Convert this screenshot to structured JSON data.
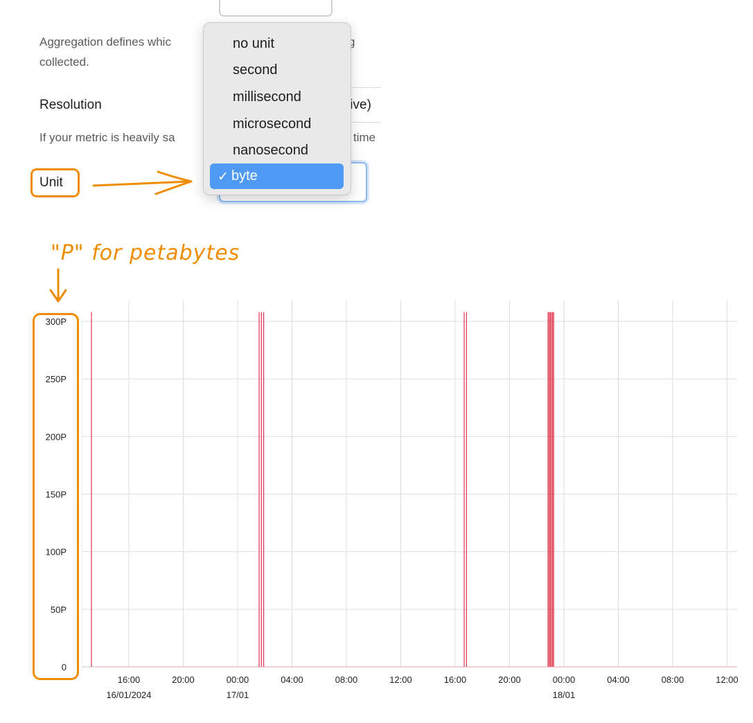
{
  "form": {
    "aggregation_text_line1_left": "Aggregation defines whic",
    "aggregation_text_line1_right": "g",
    "aggregation_text_line2": "collected.",
    "resolution_label": "Resolution",
    "resolution_value_fragment": "tive)",
    "resolution_help_left": "If your metric is heavily sa",
    "resolution_help_right": "time",
    "unit_label": "Unit"
  },
  "dropdown": {
    "options": [
      "no unit",
      "second",
      "millisecond",
      "microsecond",
      "nanosecond",
      "byte"
    ],
    "selected": "byte",
    "check_glyph": "✓"
  },
  "annotation": {
    "text": "\"P\" for petabytes",
    "color": "#f08c00"
  },
  "chart_data": {
    "type": "bar",
    "y_tick_labels": [
      "0",
      "50P",
      "100P",
      "150P",
      "200P",
      "250P",
      "300P"
    ],
    "ylim": [
      0,
      300
    ],
    "unit": "petabytes (P)",
    "x_tick_labels": [
      {
        "time": "16:00",
        "date": "16/01/2024"
      },
      {
        "time": "20:00",
        "date": ""
      },
      {
        "time": "00:00",
        "date": "17/01"
      },
      {
        "time": "04:00",
        "date": ""
      },
      {
        "time": "08:00",
        "date": ""
      },
      {
        "time": "12:00",
        "date": ""
      },
      {
        "time": "16:00",
        "date": ""
      },
      {
        "time": "20:00",
        "date": ""
      },
      {
        "time": "00:00",
        "date": "18/01"
      },
      {
        "time": "04:00",
        "date": ""
      },
      {
        "time": "08:00",
        "date": ""
      },
      {
        "time": "12:00",
        "date": ""
      }
    ],
    "spike_times": [
      "16/01/2024 13:15",
      "17/01 01:35",
      "17/01 01:45",
      "17/01 01:55",
      "17/01 16:40",
      "17/01 16:50",
      "17/01 22:50",
      "17/01 22:55",
      "17/01 23:00",
      "17/01 23:05",
      "17/01 23:10",
      "17/01 23:15"
    ],
    "spike_value": 308,
    "bar_color": "#e0314b",
    "grid": true
  }
}
